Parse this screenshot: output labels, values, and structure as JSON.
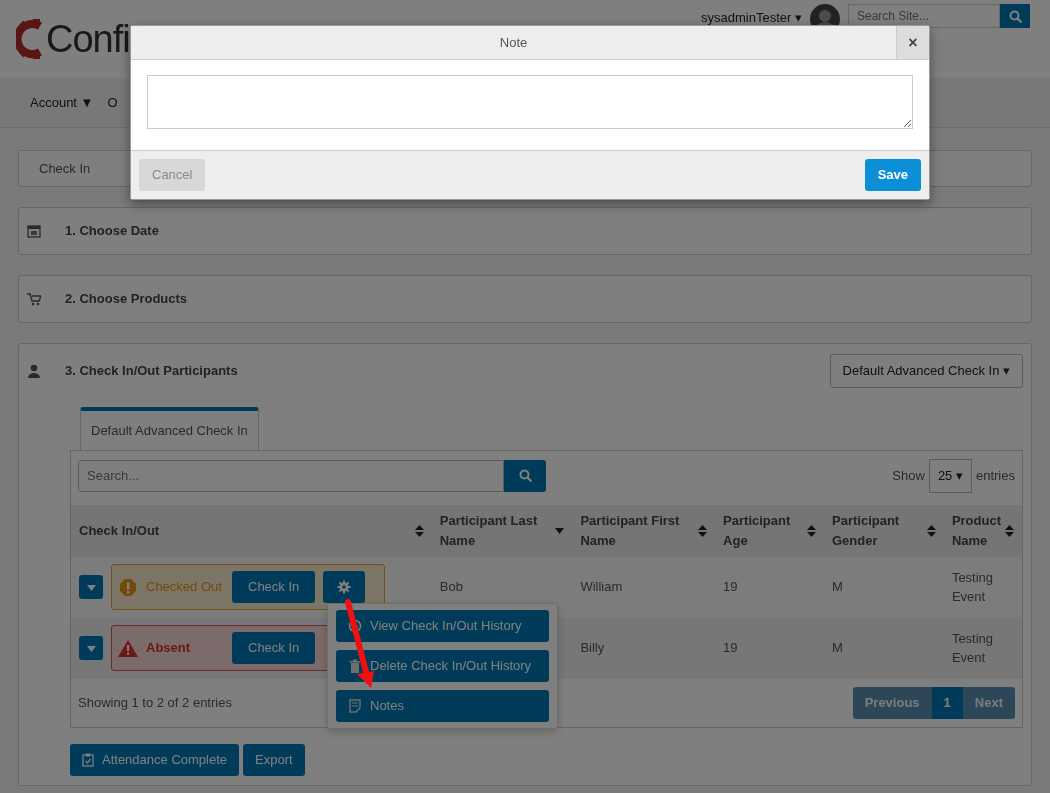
{
  "header": {
    "logo": "Confi",
    "user": "sysadminTester ▾",
    "site_search": {
      "placeholder": "Search Site..."
    }
  },
  "nav": [
    {
      "label": "Account ▼"
    },
    {
      "label": "O"
    }
  ],
  "breadcrumb": "Check In",
  "sections": [
    {
      "title": "1. Choose Date"
    },
    {
      "title": "2. Choose Products"
    }
  ],
  "participants": {
    "title": "3. Check In/Out Participants",
    "template_select": "Default Advanced Check In ▾",
    "tabs": [
      {
        "label": "Default Advanced Check In",
        "selected": true
      }
    ],
    "search": {
      "placeholder": "Search..."
    },
    "show_label": "Show",
    "page_size": "25 ▾",
    "entries_label": "entries",
    "columns": [
      {
        "label": "Check In/Out",
        "sorted": false
      },
      {
        "label": "Participant Last Name",
        "sorted": true
      },
      {
        "label": "Participant First Name",
        "sorted": false
      },
      {
        "label": "Participant Age",
        "sorted": false
      },
      {
        "label": "Participant Gender",
        "sorted": false
      },
      {
        "label": "Product Name",
        "sorted": false
      }
    ],
    "rows": [
      {
        "status": "Checked Out",
        "kind": "checked_out",
        "check_in": "Check In",
        "last_name": "Bob",
        "first_name": "William",
        "age": "19",
        "gender": "M",
        "product": "Testing Event",
        "menu": [
          "View Check In/Out History",
          "Delete Check In/Out History",
          "Notes"
        ]
      },
      {
        "status": "Absent",
        "kind": "absent",
        "check_in": "Check In",
        "first_name": "Billy",
        "age": "19",
        "gender": "M",
        "product": "Testing Event"
      }
    ],
    "info": "Showing 1 to 2 of 2 entries",
    "pagination": {
      "previous": {
        "label": "Previous",
        "disabled": true
      },
      "pages": [
        {
          "label": "1",
          "selected": true
        }
      ],
      "next": {
        "label": "Next",
        "disabled": true
      }
    },
    "actions": [
      "Attendance Complete",
      "Export"
    ]
  },
  "modal": {
    "title": "Note",
    "close": "×",
    "cancel": {
      "label": "Cancel",
      "disabled": true
    },
    "save": {
      "label": "Save",
      "disabled": false
    }
  }
}
